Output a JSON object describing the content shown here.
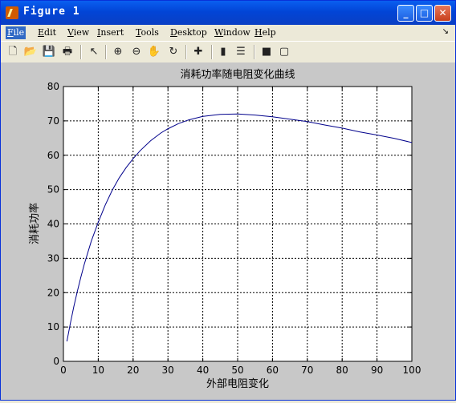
{
  "window": {
    "title": "Figure 1"
  },
  "menu": {
    "items": [
      {
        "lead": "F",
        "rest": "ile"
      },
      {
        "lead": "E",
        "rest": "dit"
      },
      {
        "lead": "V",
        "rest": "iew"
      },
      {
        "lead": "I",
        "rest": "nsert"
      },
      {
        "lead": "T",
        "rest": "ools"
      },
      {
        "lead": "D",
        "rest": "esktop"
      },
      {
        "lead": "W",
        "rest": "indow"
      },
      {
        "lead": "H",
        "rest": "elp"
      }
    ]
  },
  "toolbar": {
    "icons": [
      "new-file-icon",
      "open-folder-icon",
      "save-icon",
      "print-icon",
      "pointer-icon",
      "zoom-in-icon",
      "zoom-out-icon",
      "pan-hand-icon",
      "rotate-3d-icon",
      "data-cursor-icon",
      "colorbar-icon",
      "legend-icon",
      "hide-tools-icon",
      "show-tools-icon"
    ]
  },
  "chart_data": {
    "type": "line",
    "title": "消耗功率随电阻变化曲线",
    "xlabel": "外部电阻变化",
    "ylabel": "消耗功率",
    "xlim": [
      0,
      100
    ],
    "ylim": [
      0,
      80
    ],
    "xticks": [
      0,
      10,
      20,
      30,
      40,
      50,
      60,
      70,
      80,
      90,
      100
    ],
    "yticks": [
      0,
      10,
      20,
      30,
      40,
      50,
      60,
      70,
      80
    ],
    "grid": true,
    "line_color": "#00008b",
    "x": [
      1,
      2,
      3,
      4,
      5,
      6,
      8,
      10,
      12,
      14,
      16,
      18,
      20,
      22,
      25,
      28,
      30,
      33,
      36,
      40,
      45,
      50,
      55,
      60,
      65,
      70,
      75,
      80,
      85,
      90,
      95,
      100
    ],
    "y": [
      5.8,
      11.1,
      16.0,
      20.4,
      24.5,
      28.3,
      35.0,
      40.5,
      45.5,
      49.8,
      53.4,
      56.4,
      59.0,
      61.3,
      64.2,
      66.5,
      67.7,
      69.2,
      70.3,
      71.3,
      71.9,
      72.0,
      71.7,
      71.2,
      70.5,
      69.8,
      68.8,
      67.9,
      66.8,
      65.9,
      64.9,
      63.7
    ]
  }
}
